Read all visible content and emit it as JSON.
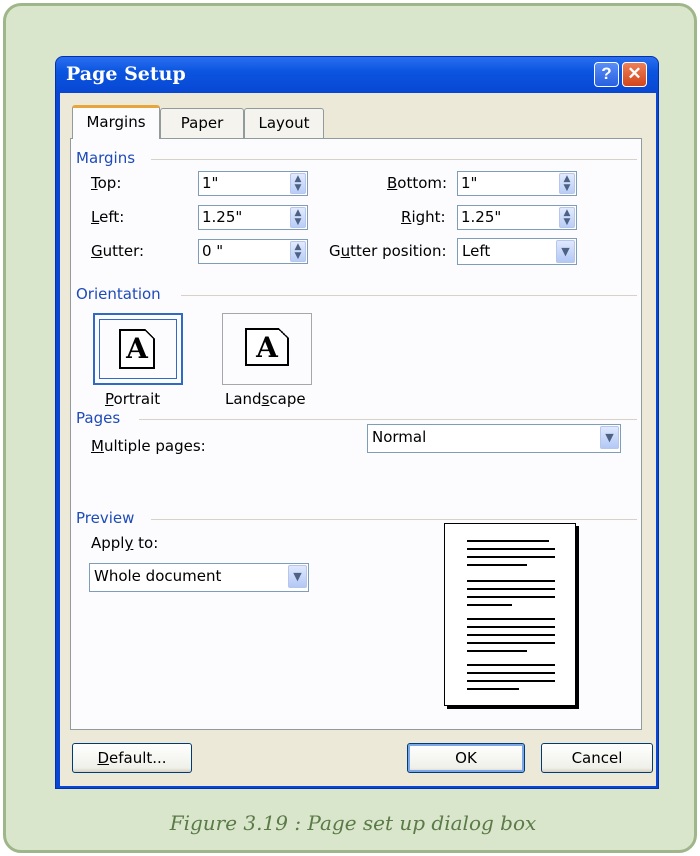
{
  "window": {
    "title": "Page Setup",
    "help_label": "?",
    "close_label": "✕"
  },
  "tabs": [
    {
      "label": "Margins",
      "active": true
    },
    {
      "label": "Paper",
      "active": false
    },
    {
      "label": "Layout",
      "active": false
    }
  ],
  "margins": {
    "group_label": "Margins",
    "top_label": "Top:",
    "top_value": "1\"",
    "bottom_label": "Bottom:",
    "bottom_value": "1\"",
    "left_label": "Left:",
    "left_value": "1.25\"",
    "right_label": "Right:",
    "right_value": "1.25\"",
    "gutter_label": "Gutter:",
    "gutter_value": "0 \"",
    "gutter_position_label": "Gutter position:",
    "gutter_position_value": "Left"
  },
  "orientation": {
    "group_label": "Orientation",
    "portrait_label": "Portrait",
    "landscape_label": "Landscape",
    "selected": "Portrait",
    "icon_letter": "A"
  },
  "pages": {
    "group_label": "Pages",
    "multiple_pages_label": "Multiple pages:",
    "multiple_pages_value": "Normal"
  },
  "preview": {
    "group_label": "Preview",
    "apply_to_label": "Apply to:",
    "apply_to_value": "Whole document"
  },
  "buttons": {
    "default_label": "Default...",
    "ok_label": "OK",
    "cancel_label": "Cancel"
  },
  "caption": "Figure 3.19 : Page set up dialog box",
  "icons": {
    "spin": "spin-arrows-icon",
    "dropdown": "chevron-down-icon"
  },
  "colors": {
    "titlebar": "#0b55e0",
    "dialog_bg": "#ece9d8",
    "group_label": "#1f4bb8",
    "frame_bg": "#d9e6cc",
    "caption": "#5a7a47"
  }
}
